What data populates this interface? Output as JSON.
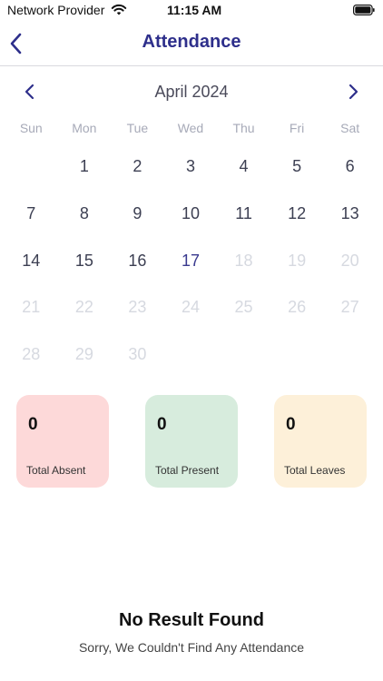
{
  "status_bar": {
    "carrier": "Network Provider",
    "time": "11:15 AM",
    "wifi_icon": "wifi-icon",
    "battery_icon": "battery-icon"
  },
  "header": {
    "title": "Attendance",
    "back_icon": "chevron-left-icon"
  },
  "calendar": {
    "month_label": "April 2024",
    "prev_icon": "chevron-left-icon",
    "next_icon": "chevron-right-icon",
    "weekdays": [
      "Sun",
      "Mon",
      "Tue",
      "Wed",
      "Thu",
      "Fri",
      "Sat"
    ],
    "days": [
      {
        "label": "",
        "state": "empty"
      },
      {
        "label": "1",
        "state": "active"
      },
      {
        "label": "2",
        "state": "active"
      },
      {
        "label": "3",
        "state": "active"
      },
      {
        "label": "4",
        "state": "active"
      },
      {
        "label": "5",
        "state": "active"
      },
      {
        "label": "6",
        "state": "active"
      },
      {
        "label": "7",
        "state": "active"
      },
      {
        "label": "8",
        "state": "active"
      },
      {
        "label": "9",
        "state": "active"
      },
      {
        "label": "10",
        "state": "active"
      },
      {
        "label": "11",
        "state": "active"
      },
      {
        "label": "12",
        "state": "active"
      },
      {
        "label": "13",
        "state": "active"
      },
      {
        "label": "14",
        "state": "active"
      },
      {
        "label": "15",
        "state": "active"
      },
      {
        "label": "16",
        "state": "active"
      },
      {
        "label": "17",
        "state": "today"
      },
      {
        "label": "18",
        "state": "disabled"
      },
      {
        "label": "19",
        "state": "disabled"
      },
      {
        "label": "20",
        "state": "disabled"
      },
      {
        "label": "21",
        "state": "disabled"
      },
      {
        "label": "22",
        "state": "disabled"
      },
      {
        "label": "23",
        "state": "disabled"
      },
      {
        "label": "24",
        "state": "disabled"
      },
      {
        "label": "25",
        "state": "disabled"
      },
      {
        "label": "26",
        "state": "disabled"
      },
      {
        "label": "27",
        "state": "disabled"
      },
      {
        "label": "28",
        "state": "disabled"
      },
      {
        "label": "29",
        "state": "disabled"
      },
      {
        "label": "30",
        "state": "disabled"
      }
    ]
  },
  "summary": {
    "absent": {
      "count": "0",
      "label": "Total Absent"
    },
    "present": {
      "count": "0",
      "label": "Total Present"
    },
    "leaves": {
      "count": "0",
      "label": "Total Leaves"
    }
  },
  "empty_state": {
    "title": "No Result Found",
    "subtitle": "Sorry, We Couldn't Find Any Attendance"
  },
  "colors": {
    "accent": "#2e2f8b",
    "absent_card": "#fdd9d9",
    "present_card": "#d7ecdd",
    "leaves_card": "#fdf0d9",
    "disabled_day": "#d6d9e0"
  }
}
